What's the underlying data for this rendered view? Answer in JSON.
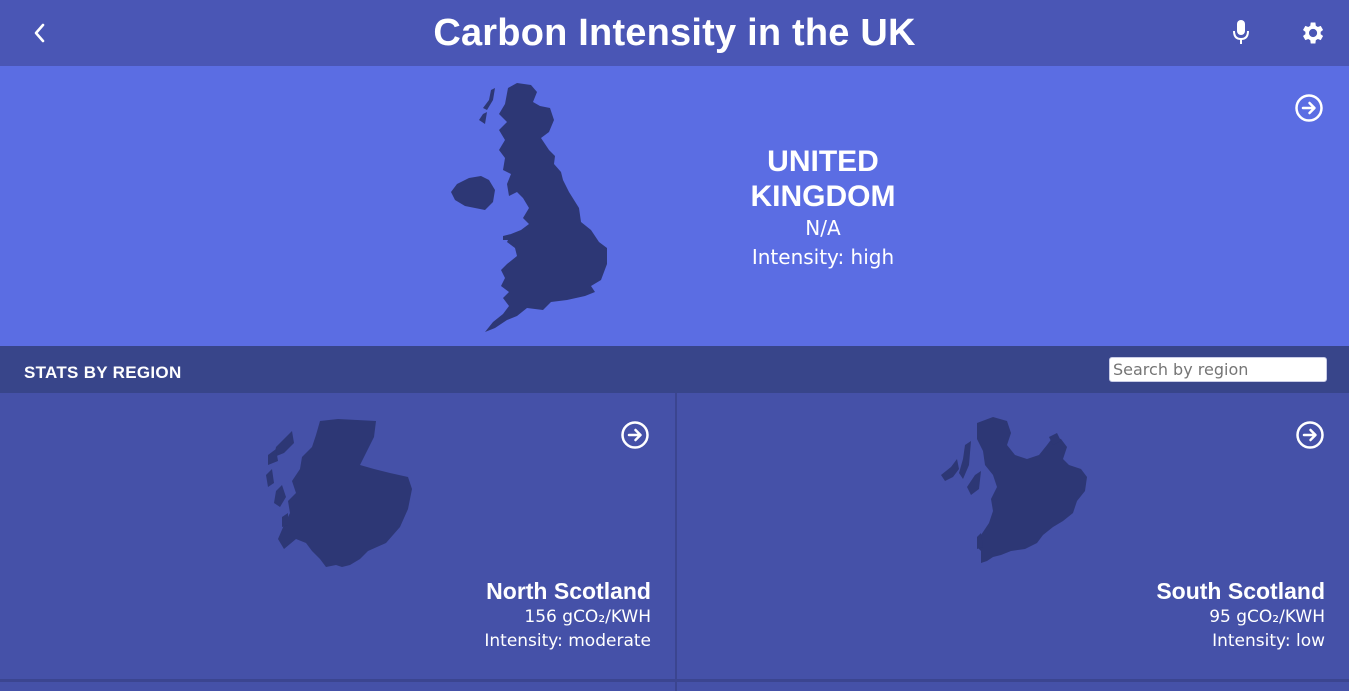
{
  "header": {
    "title": "Carbon Intensity in the UK",
    "back_icon": "chevron-left-icon",
    "mic_icon": "microphone-icon",
    "settings_icon": "gear-icon"
  },
  "national": {
    "name": "UNITED KINGDOM",
    "value": "N/A",
    "intensity": "Intensity: high",
    "map_icon": "uk-map-icon",
    "arrow_icon": "arrow-right-circle-icon"
  },
  "regions_section": {
    "title": "STATS BY REGION",
    "search_placeholder": "Search by region"
  },
  "regions": [
    {
      "name": "North Scotland",
      "value": "156 gCO₂/KWH",
      "intensity": "Intensity: moderate"
    },
    {
      "name": "South Scotland",
      "value": "95 gCO₂/KWH",
      "intensity": "Intensity: low"
    }
  ],
  "colors": {
    "header": "#4a56b5",
    "hero": "#5b6de3",
    "section_bar": "#38458a",
    "card": "#4551a8",
    "map_fill": "#2d3775"
  }
}
